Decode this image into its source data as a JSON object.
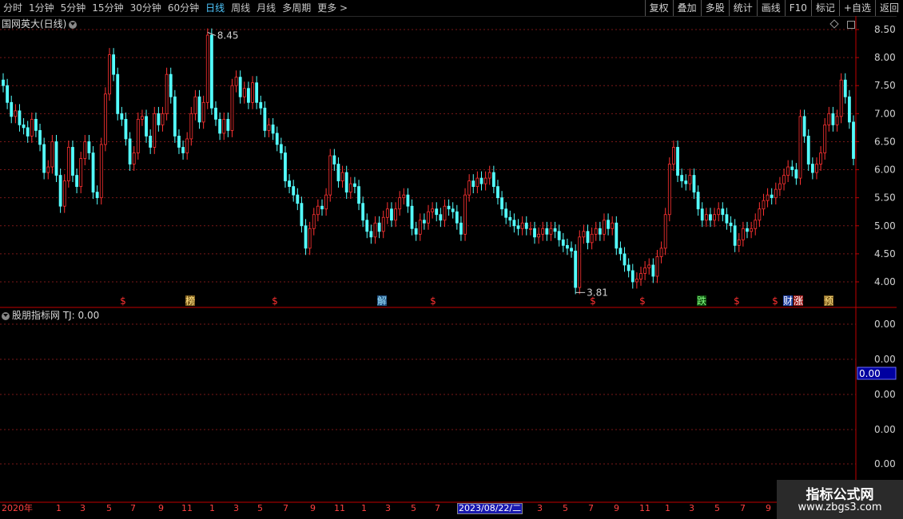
{
  "toolbar": {
    "periods": [
      "分时",
      "1分钟",
      "5分钟",
      "15分钟",
      "30分钟",
      "60分钟",
      "日线",
      "周线",
      "月线",
      "多周期",
      "更多 >"
    ],
    "active_period": "日线",
    "tools": [
      "复权",
      "叠加",
      "多股",
      "统计",
      "画线",
      "F10",
      "标记",
      "+自选",
      "返回"
    ]
  },
  "main_panel": {
    "title": "国网英大(日线)",
    "high_label": "8.45",
    "low_label": "3.81",
    "price_axis": [
      "8.50",
      "8.00",
      "7.50",
      "7.00",
      "6.50",
      "6.00",
      "5.50",
      "5.00",
      "4.50",
      "4.00"
    ],
    "markers": [
      {
        "text": "$",
        "color": "#ff3030",
        "bg": ""
      },
      {
        "text": "榜",
        "color": "#ffe080",
        "bg": "#806020"
      },
      {
        "text": "$",
        "color": "#ff3030",
        "bg": ""
      },
      {
        "text": "解",
        "color": "#9fe6ff",
        "bg": "#205080"
      },
      {
        "text": "$",
        "color": "#ff3030",
        "bg": ""
      },
      {
        "text": "$",
        "color": "#ff3030",
        "bg": ""
      },
      {
        "text": "$",
        "color": "#ff3030",
        "bg": ""
      },
      {
        "text": "跌",
        "color": "#80ff80",
        "bg": "#105010"
      },
      {
        "text": "$",
        "color": "#ff3030",
        "bg": ""
      },
      {
        "text": "$",
        "color": "#ff3030",
        "bg": ""
      },
      {
        "text": "财",
        "color": "#ffffff",
        "bg": "#2040a0"
      },
      {
        "text": "涨",
        "color": "#ffffff",
        "bg": "#a02020"
      },
      {
        "text": "预",
        "color": "#ffe080",
        "bg": "#806020"
      }
    ]
  },
  "sub_panel": {
    "title": "股朋指标网 TJ: 0.00",
    "axis_labels": [
      "0.00",
      "0.00",
      "0.00",
      "0.00",
      "0.00"
    ],
    "current_value": "0.00"
  },
  "date_axis": {
    "labels": [
      "2020年",
      "1",
      "3",
      "5",
      "7",
      "9",
      "11",
      "1",
      "3",
      "5",
      "7",
      "9",
      "11",
      "1",
      "3",
      "5",
      "7",
      "3",
      "5",
      "7",
      "9",
      "11",
      "1",
      "3",
      "5",
      "7",
      "9"
    ],
    "current_date": "2023/08/22/二"
  },
  "watermark": {
    "line1": "指标公式网",
    "line2": "www.zbgs3.com"
  },
  "chart_data": {
    "type": "candlestick",
    "series": [
      {
        "values": [
          7.5,
          7.2,
          6.95,
          7.05,
          6.8,
          6.75,
          6.6,
          6.9,
          6.7,
          6.45,
          5.95,
          6.05,
          6.5,
          5.9,
          5.35,
          5.8,
          6.4,
          5.9,
          5.7,
          6.2,
          6.5,
          6.3,
          5.6,
          5.5,
          6.45,
          7.35,
          8.05,
          7.7,
          7.0,
          6.9,
          6.55,
          6.1,
          6.3,
          6.9,
          6.95,
          6.6,
          6.4,
          7.0,
          6.8,
          7.0,
          7.7,
          7.3,
          6.6,
          6.4,
          6.3,
          6.55,
          7.0,
          7.3,
          6.85,
          7.2,
          8.4,
          7.1,
          6.9,
          6.65,
          6.9,
          6.7,
          7.5,
          7.65,
          7.3,
          7.45,
          7.2,
          7.55,
          7.2,
          7.1,
          6.7,
          6.8,
          6.65,
          6.45,
          6.3,
          5.8,
          5.7,
          5.55,
          5.4,
          5.0,
          4.6,
          4.95,
          5.2,
          5.35,
          5.3,
          5.55,
          6.25,
          6.1,
          5.8,
          5.95,
          5.6,
          5.75,
          5.7,
          5.4,
          5.1,
          4.9,
          4.8,
          5.05,
          4.9,
          5.15,
          5.3,
          5.1,
          5.3,
          5.5,
          5.55,
          5.35,
          4.95,
          4.85,
          5.1,
          5.05,
          5.25,
          5.3,
          5.2,
          5.1,
          5.35,
          5.3,
          5.25,
          5.05,
          4.85,
          5.55,
          5.8,
          5.7,
          5.85,
          5.75,
          5.85,
          5.95,
          5.7,
          5.5,
          5.3,
          5.15,
          5.1,
          5.0,
          4.95,
          5.05,
          4.95,
          4.95,
          4.8,
          4.85,
          4.95,
          4.85,
          4.95,
          4.9,
          4.75,
          4.65,
          4.6,
          4.55,
          3.9,
          4.8,
          4.9,
          4.7,
          4.85,
          4.95,
          4.85,
          5.1,
          4.95,
          5.05,
          4.6,
          4.5,
          4.3,
          4.2,
          4.0,
          4.05,
          4.15,
          4.25,
          4.3,
          4.1,
          4.45,
          4.6,
          5.2,
          6.1,
          6.4,
          5.9,
          5.8,
          5.75,
          5.9,
          5.6,
          5.3,
          5.1,
          5.2,
          5.1,
          5.2,
          5.3,
          5.2,
          5.05,
          5.0,
          4.65,
          4.75,
          4.95,
          4.9,
          4.95,
          5.1,
          5.3,
          5.45,
          5.55,
          5.5,
          5.65,
          5.75,
          5.9,
          6.05,
          6.0,
          5.85,
          6.95,
          6.6,
          6.1,
          5.95,
          6.1,
          6.3,
          6.8,
          7.0,
          6.8,
          6.95,
          7.6,
          7.3,
          6.85,
          6.2
        ]
      }
    ],
    "ylim": [
      3.8,
      8.6
    ],
    "ylabel": "",
    "y_ticks": [
      8.5,
      8.0,
      7.5,
      7.0,
      6.5,
      6.0,
      5.5,
      5.0,
      4.5,
      4.0
    ],
    "indicator": {
      "name": "TJ",
      "value": 0.0
    },
    "high": 8.45,
    "low": 3.81
  },
  "colors": {
    "up": "#ff3232",
    "down": "#54ffff",
    "grid": "#7a1818",
    "axis": "#c00000",
    "text": "#c8c8c8"
  }
}
